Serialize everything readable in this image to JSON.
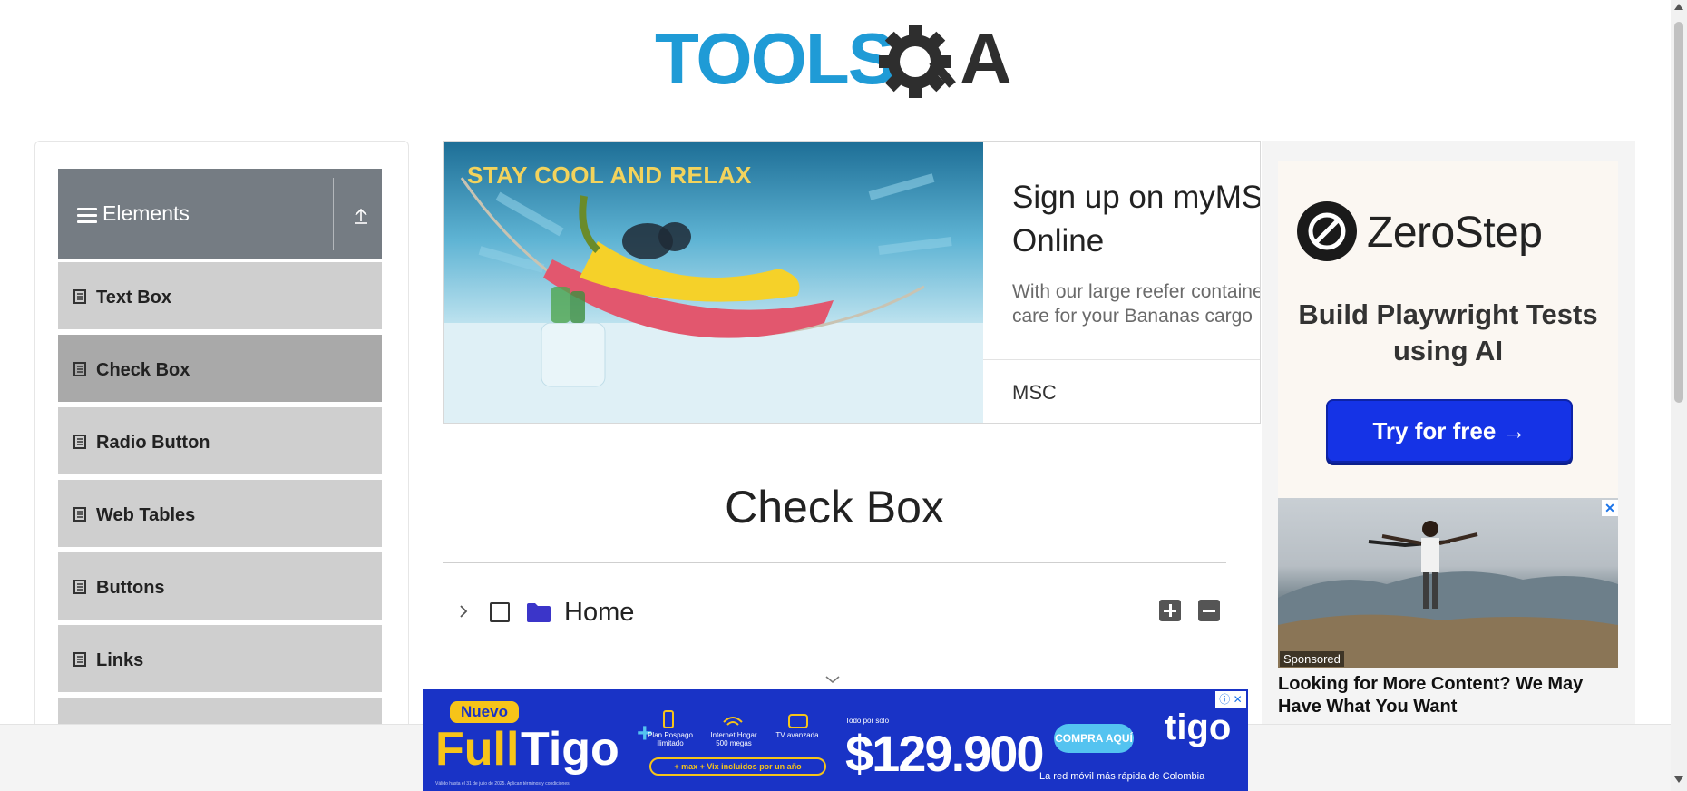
{
  "header": {
    "logo_text": "TOOLSQA"
  },
  "sidebar": {
    "group_title": "Elements",
    "items": [
      {
        "label": "Text Box"
      },
      {
        "label": "Check Box",
        "active": true
      },
      {
        "label": "Radio Button"
      },
      {
        "label": "Web Tables"
      },
      {
        "label": "Buttons"
      },
      {
        "label": "Links"
      },
      {
        "label": ""
      }
    ]
  },
  "top_ad": {
    "headline": "STAY COOL AND RELAX",
    "title": "Sign up on myMSC Online",
    "description": "With our large reefer containers, we care for your Bananas cargo",
    "brand": "MSC"
  },
  "main": {
    "title": "Check Box",
    "tree": {
      "root_label": "Home",
      "checked": false,
      "expanded": false
    }
  },
  "right_ad": {
    "brand": "ZeroStep",
    "tagline": "Build Playwright Tests using AI",
    "cta": "Try for free →",
    "sponsored_label": "Sponsored",
    "sponsored_headline": "Looking for More Content? We May Have What You Want",
    "close_glyph": "✕"
  },
  "bottom_ad": {
    "badge": "Nuevo",
    "product_prefix": "Full",
    "product_name": "Tigo",
    "feature_1": "Plan Pospago ilimitado",
    "feature_2": "Internet Hogar 500 megas",
    "feature_3": "TV avanzada",
    "included": "+ max + Vix incluidos por un año",
    "price_label": "Todo por solo",
    "price": "$129.900",
    "cta": "COMPRA AQUÍ",
    "logo": "tigo",
    "slogan": "La red móvil más rápida de Colombia",
    "fine_print": "Válido hasta el 31 de julio de 2025. Aplican términos y condiciones.",
    "ad_choices": "ⓘ ✕"
  },
  "colors": {
    "sidebar_header": "#757c83",
    "menu_item": "#cfcfcf",
    "menu_item_active": "#a9a9a9",
    "cta_blue": "#1533e6",
    "tigo_blue": "#1933c6",
    "tigo_yellow": "#f6c419",
    "folder": "#3b35c9"
  }
}
